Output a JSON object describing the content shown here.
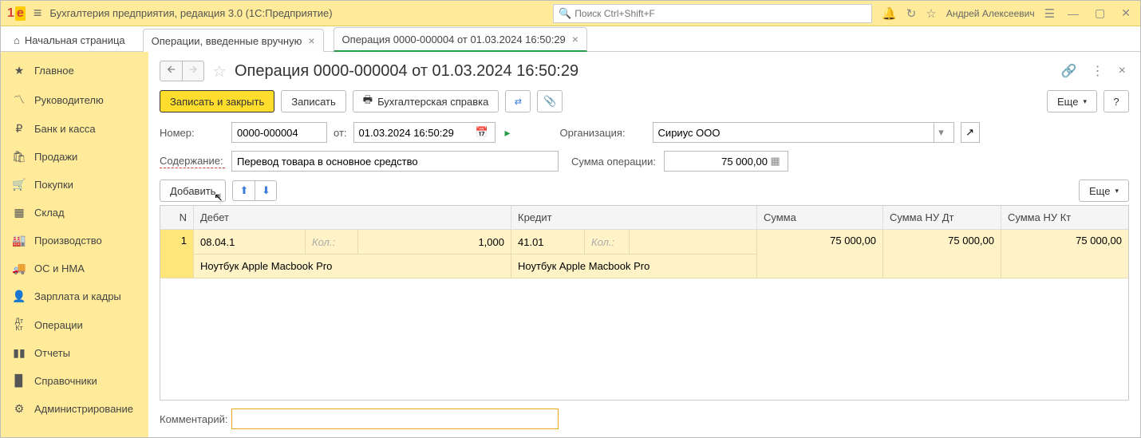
{
  "app": {
    "title": "Бухгалтерия предприятия, редакция 3.0  (1С:Предприятие)",
    "search_placeholder": "Поиск Ctrl+Shift+F",
    "user": "Андрей Алексеевич"
  },
  "tabs": {
    "home": "Начальная страница",
    "t1": "Операции, введенные вручную",
    "t2": "Операция 0000-000004 от 01.03.2024 16:50:29"
  },
  "sidebar": {
    "items": [
      {
        "label": "Главное",
        "icon": "★"
      },
      {
        "label": "Руководителю",
        "icon": "📈"
      },
      {
        "label": "Банк и касса",
        "icon": "₽"
      },
      {
        "label": "Продажи",
        "icon": "🛍"
      },
      {
        "label": "Покупки",
        "icon": "🛒"
      },
      {
        "label": "Склад",
        "icon": "▦"
      },
      {
        "label": "Производство",
        "icon": "🏭"
      },
      {
        "label": "ОС и НМА",
        "icon": "🚚"
      },
      {
        "label": "Зарплата и кадры",
        "icon": "👤"
      },
      {
        "label": "Операции",
        "icon": "Дт"
      },
      {
        "label": "Отчеты",
        "icon": "📊"
      },
      {
        "label": "Справочники",
        "icon": "📕"
      },
      {
        "label": "Администрирование",
        "icon": "⚙"
      }
    ]
  },
  "doc": {
    "title": "Операция 0000-000004 от 01.03.2024 16:50:29",
    "btn_save_close": "Записать и закрыть",
    "btn_save": "Записать",
    "btn_print": "Бухгалтерская справка",
    "btn_more": "Еще",
    "lbl_number": "Номер:",
    "number": "0000-000004",
    "lbl_from": "от:",
    "date": "01.03.2024 16:50:29",
    "lbl_org": "Организация:",
    "org": "Сириус ООО",
    "lbl_content": "Содержание:",
    "content": "Перевод товара в основное средство",
    "lbl_sum": "Сумма операции:",
    "sum": "75 000,00",
    "btn_add": "Добавить",
    "lbl_comment": "Комментарий:"
  },
  "grid": {
    "cols": {
      "n": "N",
      "debit": "Дебет",
      "credit": "Кредит",
      "sum": "Сумма",
      "nudt": "Сумма НУ Дт",
      "nukt": "Сумма НУ Кт"
    },
    "row": {
      "n": "1",
      "debit_acc": "08.04.1",
      "qty_lbl": "Кол.:",
      "debit_qty": "1,000",
      "debit_name": "Ноутбук Apple Macbook Pro",
      "credit_acc": "41.01",
      "credit_name": "Ноутбук Apple Macbook Pro",
      "sum": "75 000,00",
      "nudt": "75 000,00",
      "nukt": "75 000,00"
    }
  }
}
